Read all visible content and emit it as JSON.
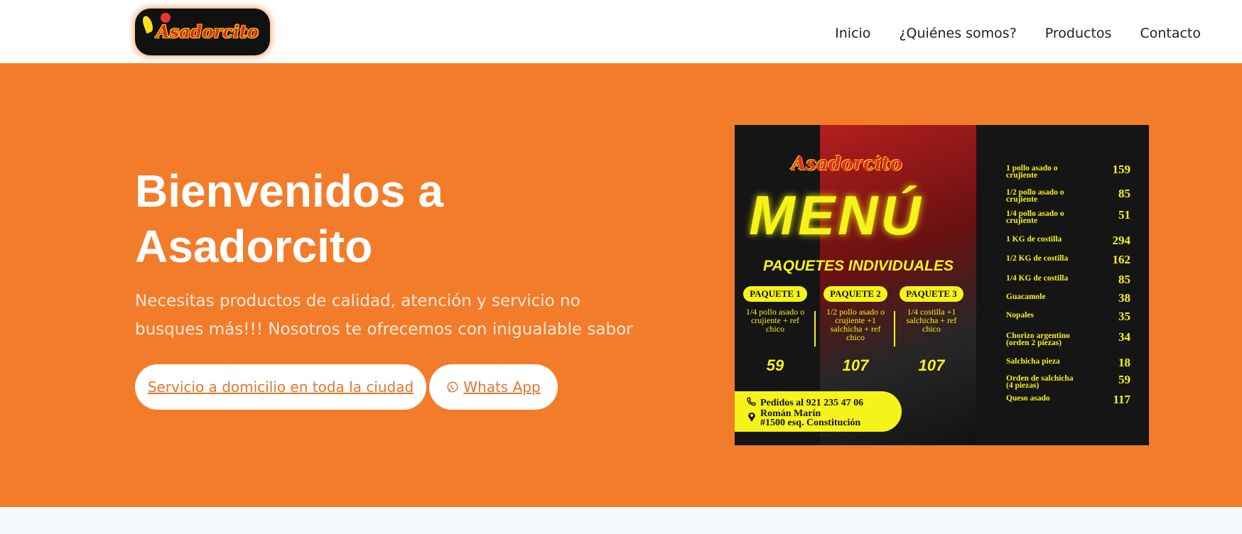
{
  "header": {
    "logo_text": "Asadorcito",
    "nav": [
      "Inicio",
      "¿Quiénes somos?",
      "Productos",
      "Contacto"
    ]
  },
  "hero": {
    "title_line1": "Bienvenidos a",
    "title_line2": "Asadorcito",
    "subtitle": "Necesitas productos de calidad, atención y servicio no busques más!!! Nosotros te ofrecemos con inigualable sabor",
    "button_delivery": "Servicio a domicilio en toda la ciudad",
    "button_whatsapp": "Whats App"
  },
  "menu_image": {
    "logo": "Asadorcito",
    "title": "MENÚ",
    "subtitle": "PAQUETES INDIVIDUALES",
    "packages": [
      {
        "tag": "PAQUETE 1",
        "desc": "1/4 pollo asado o crujiente + ref chico",
        "price": "59"
      },
      {
        "tag": "PAQUETE 2",
        "desc": "1/2 pollo asado o crujiente +1 salchicha + ref chico",
        "price": "107"
      },
      {
        "tag": "PAQUETE 3",
        "desc": "1/4 costilla +1 salchicha + ref chico",
        "price": "107"
      }
    ],
    "contact_phone": "Pedidos al 921 235 47 06",
    "contact_address_1": "Román Marín",
    "contact_address_2": "#1500 esq. Constitución",
    "items": [
      {
        "name": "1 pollo asado o crujiente",
        "price": "159"
      },
      {
        "name": "1/2 pollo asado o crujiente",
        "price": "85"
      },
      {
        "name": "1/4 pollo asado o crujiente",
        "price": "51"
      },
      {
        "name": "1 KG de costilla",
        "price": "294"
      },
      {
        "name": "1/2 KG de costilla",
        "price": "162"
      },
      {
        "name": "1/4 KG de costilla",
        "price": "85"
      },
      {
        "name": "Guacamole",
        "price": "38"
      },
      {
        "name": "Nopales",
        "price": "35"
      },
      {
        "name": "Chorizo argentino (orden 2 piezas)",
        "price": "34"
      },
      {
        "name": "Salchicha pieza",
        "price": "18"
      },
      {
        "name": "Orden de salchicha (4 piezas)",
        "price": "59"
      },
      {
        "name": "Queso asado",
        "price": "117"
      }
    ]
  },
  "colors": {
    "brand_orange": "#f37c2b",
    "menu_yellow": "#f5f31a"
  }
}
